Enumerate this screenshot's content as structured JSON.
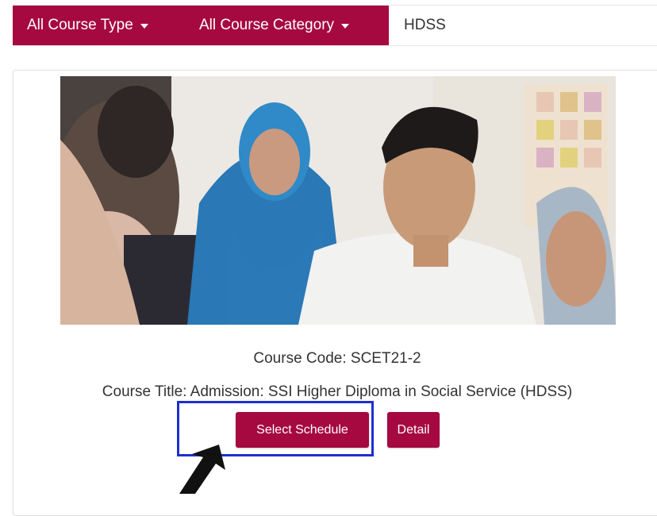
{
  "filters": {
    "course_type_label": "All Course Type",
    "course_category_label": "All Course Category",
    "search_value": "HDSS"
  },
  "course": {
    "code_line": "Course Code: SCET21-2",
    "title_line": "Course Title: Admission: SSI Higher Diploma in Social Service (HDSS)",
    "select_schedule_label": "Select Schedule",
    "detail_label": "Detail"
  },
  "icons": {
    "dropdown_caret": "caret-down-icon",
    "pointer": "arrow-cursor-icon"
  },
  "colors": {
    "brand": "#a5093f",
    "highlight": "#1f2fcf"
  }
}
